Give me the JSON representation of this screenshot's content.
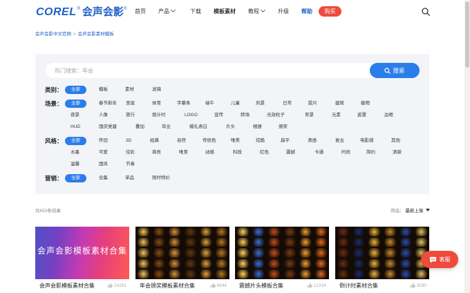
{
  "header": {
    "logo_corel": "COREL",
    "logo_reg": "®",
    "logo_cn": "会声会影",
    "logo_cn_reg": "®",
    "nav": [
      {
        "label": "首页",
        "dropdown": false
      },
      {
        "label": "产品",
        "dropdown": true
      },
      {
        "label": "下载",
        "dropdown": false
      },
      {
        "label": "模板素材",
        "dropdown": false
      },
      {
        "label": "教程",
        "dropdown": true
      },
      {
        "label": "升级",
        "dropdown": false
      },
      {
        "label": "帮助",
        "dropdown": false
      }
    ],
    "buy_label": "购买",
    "search_icon": "search-icon"
  },
  "breadcrumb": {
    "home": "会声会影中文官网",
    "separator": ">",
    "current": "会声会影素材模板"
  },
  "search": {
    "placeholder": "热门搜索：年会",
    "button_label": "搜索"
  },
  "filters": {
    "category": {
      "label": "类别：",
      "all": "全部",
      "tags": [
        "模板",
        "素材",
        "滤镜"
      ]
    },
    "scene": {
      "label": "场景：",
      "all": "全部",
      "rows": [
        [
          "春节新年",
          "圣诞",
          "体育",
          "字幕条",
          "端午",
          "儿童",
          "风景",
          "日常",
          "胶片",
          "建筑",
          "植物"
        ],
        [
          "夜景",
          "人像",
          "旅行",
          "倒计时",
          "LOGO",
          "宣传",
          "转场",
          "光效粒子",
          "背景",
          "元素",
          "遮罩",
          "边框"
        ],
        [
          "HUD",
          "国庆党建",
          "叠加",
          "毕业",
          "婚礼表白",
          "片头",
          "相册",
          "颁奖"
        ]
      ]
    },
    "style": {
      "label": "风格：",
      "all": "全部",
      "rows": [
        [
          "怀旧",
          "3D",
          "经典",
          "自然",
          "传统色",
          "唯美",
          "炫酷",
          "扁平",
          "清透",
          "复古",
          "电影感",
          "其他"
        ],
        [
          "水墨",
          "可爱",
          "炫彩",
          "商务",
          "唯美",
          "动感",
          "科技",
          "红色",
          "震撼",
          "卡通",
          "时尚",
          "简约",
          "清新"
        ],
        [
          "温馨",
          "国风",
          "节奏"
        ]
      ]
    },
    "sales": {
      "label": "营销：",
      "all": "全部",
      "tags": [
        "合集",
        "单品",
        "限时特价"
      ]
    }
  },
  "results": {
    "count_text": "共653条结果",
    "sort_label": "筛选：",
    "sort_value": "最新上架"
  },
  "cards": [
    {
      "title": "会声会影模板素材合集",
      "views": "24291",
      "cover_text": "会声会影模板素材合集"
    },
    {
      "title": "年会颁奖模板素材合集",
      "views": "6844"
    },
    {
      "title": "震撼片头模板合集",
      "views": "12234"
    },
    {
      "title": "倒计时素材合集",
      "views": "3590"
    }
  ],
  "service": {
    "label": "客服"
  },
  "colors": {
    "brand_blue": "#1f5fc7",
    "accent_blue": "#2b7de9",
    "buy_red": "#ee4b3c",
    "panel_bg": "#f2f4f8"
  }
}
